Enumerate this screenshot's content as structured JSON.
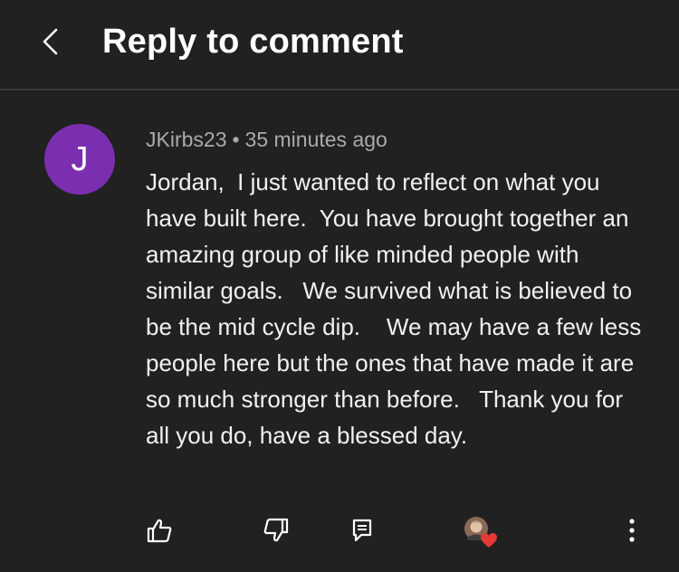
{
  "header": {
    "title": "Reply to comment",
    "back_icon": "chevron-left-icon"
  },
  "comment": {
    "avatar_letter": "J",
    "avatar_color": "#7b2fb0",
    "author": "JKirbs23",
    "separator": "•",
    "timestamp": "35 minutes ago",
    "text": "Jordan,  I just wanted to reflect on what you have built here.  You have brought together an amazing group of like minded people with similar goals.   We survived what is believed to be the mid cycle dip.    We may have a few less people here but the ones that have made it are so much stronger than before.   Thank you for all you do, have a blessed day."
  },
  "actions": {
    "like_icon": "thumbs-up-icon",
    "dislike_icon": "thumbs-down-icon",
    "reply_icon": "reply-comment-icon",
    "hearted_icon": "creator-heart-icon",
    "more_icon": "more-vertical-icon",
    "heart_color": "#e53935"
  }
}
